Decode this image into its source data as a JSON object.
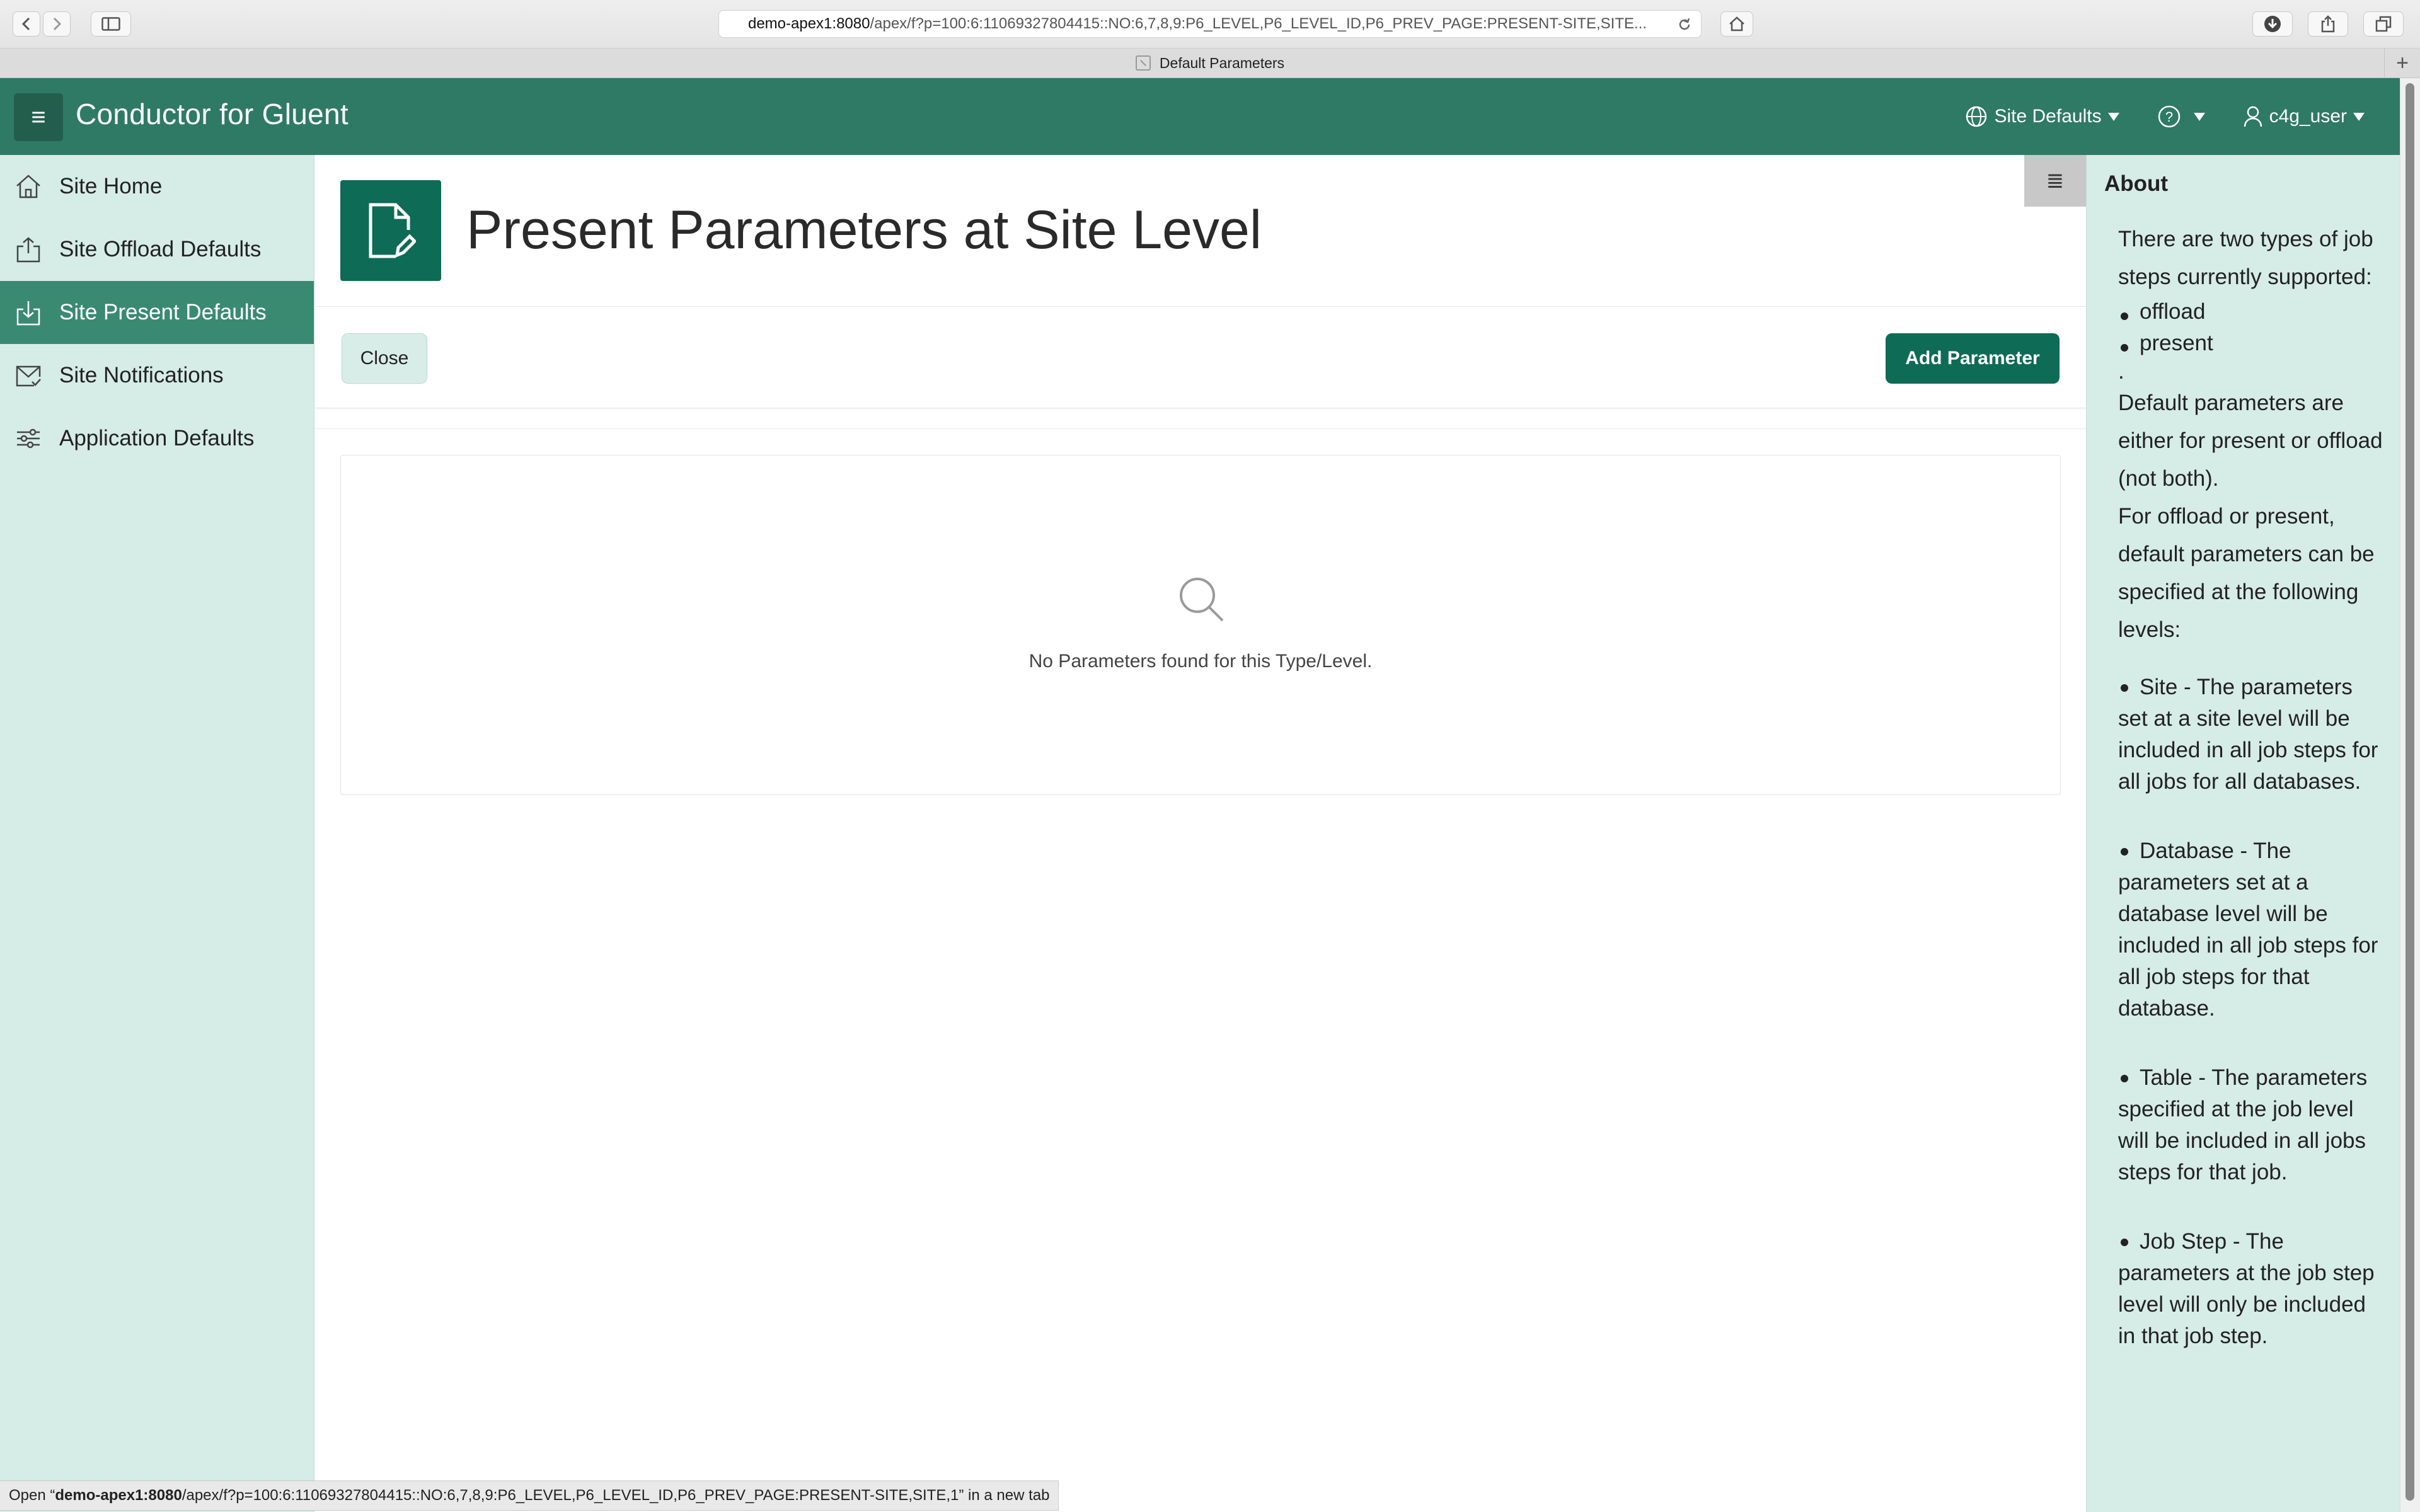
{
  "browser": {
    "url_host": "demo-apex1:8080",
    "url_path": "/apex/f?p=100:6:11069327804415::NO:6,7,8,9:P6_LEVEL,P6_LEVEL_ID,P6_PREV_PAGE:PRESENT-SITE,SITE...",
    "tab_title": "Default Parameters",
    "new_tab_icon": "plus-icon"
  },
  "header": {
    "app_title": "Conductor for Gluent",
    "menu_icon": "hamburger-icon",
    "site_defaults_label": "Site Defaults",
    "help_label": "?",
    "user_label": "c4g_user"
  },
  "sidebar": {
    "items": [
      {
        "label": "Site Home",
        "icon": "home-icon"
      },
      {
        "label": "Site Offload Defaults",
        "icon": "upload-icon"
      },
      {
        "label": "Site Present Defaults",
        "icon": "download-icon",
        "active": true
      },
      {
        "label": "Site Notifications",
        "icon": "mail-check-icon"
      },
      {
        "label": "Application Defaults",
        "icon": "sliders-icon"
      }
    ]
  },
  "main": {
    "page_title": "Present Parameters at Site Level",
    "close_label": "Close",
    "add_label": "Add Parameter",
    "empty_message": "No Parameters found for this Type/Level."
  },
  "about": {
    "title": "About",
    "intro": "There are two types of job steps currently supported:",
    "types": [
      "offload",
      "present"
    ],
    "dot": ".",
    "para1": "Default parameters are either for present or offload (not both).",
    "para2": "For offload or present, default parameters can be specified at the following levels:",
    "levels": [
      "Site - The parameters set at a site level will be included in all job steps for all jobs for all databases.",
      "Database - The parameters set at a database level will be included in all job steps for all job steps for that database.",
      "Table - The parameters specified at the job level will be included in all jobs steps for that job.",
      "Job Step - The parameters at the job step level will only be included in that job step."
    ]
  },
  "status_bar": {
    "prefix": "Open “",
    "host": "demo-apex1:8080",
    "rest": "/apex/f?p=100:6:11069327804415::NO:6,7,8,9:P6_LEVEL,P6_LEVEL_ID,P6_PREV_PAGE:PRESENT-SITE,SITE,1” in a new tab"
  },
  "colors": {
    "brand": "#2f7a64",
    "brand_dark": "#0e6b55",
    "sidebar_bg": "#d6ece7",
    "active_item": "#3a8a72"
  }
}
